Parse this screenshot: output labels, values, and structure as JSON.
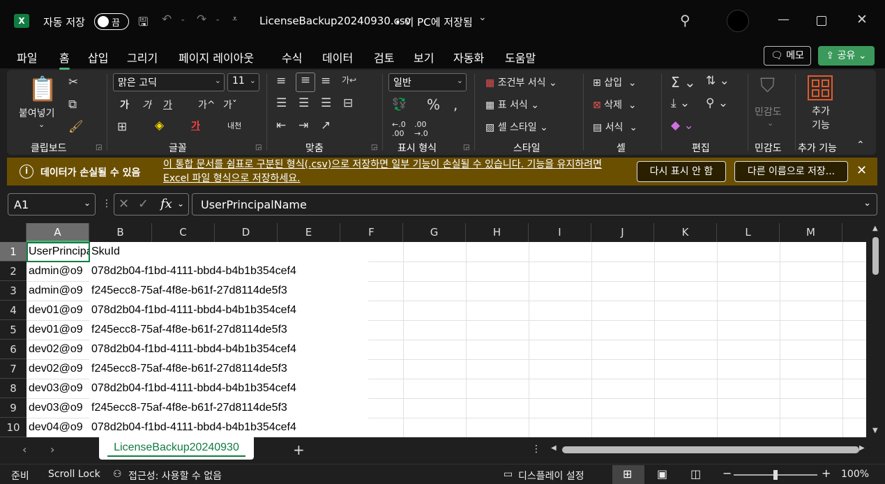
{
  "titlebar": {
    "logo": "X",
    "autosave_label": "자동 저장",
    "autosave_state": "끔",
    "filename": "LicenseBackup20240930.csv",
    "saved_status": "• 이 PC에 저장됨"
  },
  "tabs": [
    "파일",
    "홈",
    "삽입",
    "그리기",
    "페이지 레이아웃",
    "수식",
    "데이터",
    "검토",
    "보기",
    "자동화",
    "도움말"
  ],
  "actions": {
    "memo": "메모",
    "share": "공유"
  },
  "ribbon": {
    "clipboard": {
      "paste": "붙여넣기",
      "group": "클립보드"
    },
    "font": {
      "name": "맑은 고딕",
      "size": "11",
      "group": "글꼴"
    },
    "align": {
      "group": "맞춤"
    },
    "number": {
      "format": "일반",
      "group": "표시 형식"
    },
    "styles": {
      "conditional": "조건부 서식",
      "table": "표 서식",
      "cell": "셀 스타일",
      "group": "스타일"
    },
    "cells": {
      "insert": "삽입",
      "delete": "삭제",
      "format": "서식",
      "group": "셀"
    },
    "editing": {
      "group": "편집"
    },
    "sensitivity": {
      "label": "민감도",
      "group": "민감도"
    },
    "addins": {
      "label": "추가 기능",
      "group": "추가 기능"
    }
  },
  "warning": {
    "title": "데이터가 손실될 수 있음",
    "message": "이 통합 문서를 쉼표로 구분된 형식(.csv)으로 저장하면 일부 기능이 손실될 수 있습니다. 기능을 유지하려면 Excel 파일 형식으로 저장하세요.",
    "btn_dismiss": "다시 표시 안 함",
    "btn_saveas": "다른 이름으로 저장..."
  },
  "formula_bar": {
    "namebox": "A1",
    "fx": "fx",
    "value": "UserPrincipalName"
  },
  "columns": [
    "A",
    "B",
    "C",
    "D",
    "E",
    "F",
    "G",
    "H",
    "I",
    "J",
    "K",
    "L",
    "M"
  ],
  "rows": [
    "1",
    "2",
    "3",
    "4",
    "5",
    "6",
    "7",
    "8",
    "9",
    "10"
  ],
  "cells_a": [
    "UserPrincipalName",
    "admin@o9",
    "admin@o9",
    "dev01@o9",
    "dev01@o9",
    "dev02@o9",
    "dev02@o9",
    "dev03@o9",
    "dev03@o9",
    "dev04@o9"
  ],
  "cells_b": [
    "SkuId",
    "078d2b04-f1bd-4111-bbd4-b4b1b354cef4",
    "f245ecc8-75af-4f8e-b61f-27d8114de5f3",
    "078d2b04-f1bd-4111-bbd4-b4b1b354cef4",
    "f245ecc8-75af-4f8e-b61f-27d8114de5f3",
    "078d2b04-f1bd-4111-bbd4-b4b1b354cef4",
    "f245ecc8-75af-4f8e-b61f-27d8114de5f3",
    "078d2b04-f1bd-4111-bbd4-b4b1b354cef4",
    "f245ecc8-75af-4f8e-b61f-27d8114de5f3",
    "078d2b04-f1bd-4111-bbd4-b4b1b354cef4"
  ],
  "sheet_tab": "LicenseBackup20240930",
  "status": {
    "ready": "준비",
    "scroll_lock": "Scroll Lock",
    "accessibility": "접근성: 사용할 수 없음",
    "display": "디스플레이 설정",
    "zoom": "100%"
  },
  "colors": {
    "accent": "#107c41",
    "share": "#3b9a5b",
    "warning": "#6b4f00"
  }
}
